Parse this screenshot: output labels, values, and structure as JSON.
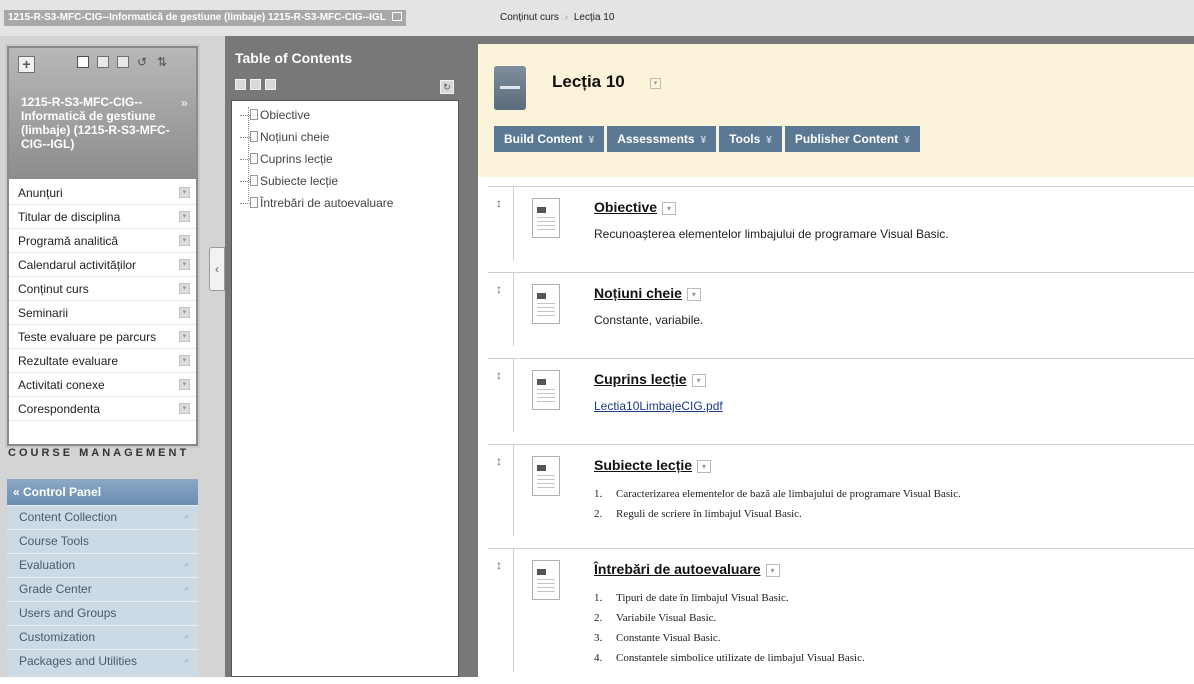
{
  "breadcrumb": {
    "course": "1215-R-S3-MFC-CIG--Informatică de gestiune (limbaje) 1215-R-S3-MFC-CIG--IGL",
    "section": "Conținut curs",
    "current": "Lecția 10"
  },
  "course_menu": {
    "course_title": "1215-R-S3-MFC-CIG--Informatică de gestiune (limbaje) (1215-R-S3-MFC-CIG--IGL)",
    "items": [
      "Anunțuri",
      "Titular de disciplina",
      "Programă analitică",
      "Calendarul activităților",
      "Conținut curs",
      "Seminarii",
      "Teste evaluare pe parcurs",
      "Rezultate evaluare",
      "Activitati conexe",
      "Corespondenta"
    ]
  },
  "course_management": {
    "heading": "COURSE MANAGEMENT",
    "control_panel": "Control Panel",
    "items": [
      "Content Collection",
      "Course Tools",
      "Evaluation",
      "Grade Center",
      "Users and Groups",
      "Customization",
      "Packages and Utilities"
    ]
  },
  "toc": {
    "title": "Table of Contents",
    "items": [
      "Obiective",
      "Noțiuni cheie",
      "Cuprins lecție",
      "Subiecte lecție",
      "Întrebări de autoevaluare"
    ]
  },
  "page": {
    "title": "Lecția 10",
    "actions": [
      "Build Content",
      "Assessments",
      "Tools",
      "Publisher Content"
    ]
  },
  "content_items": [
    {
      "title": "Obiective",
      "text": "Recunoașterea elementelor limbajului de programare Visual Basic."
    },
    {
      "title": "Noțiuni cheie",
      "text": "Constante, variabile."
    },
    {
      "title": "Cuprins lecție",
      "link": "Lectia10LimbajeCIG.pdf"
    },
    {
      "title": "Subiecte lecție",
      "list": [
        "Caracterizarea elementelor de bază ale limbajului de programare Visual Basic.",
        "Reguli de scriere în limbajul Visual Basic."
      ]
    },
    {
      "title": "Întrebări de autoevaluare",
      "list": [
        "Tipuri de date în limbajul Visual Basic.",
        "Variabile Visual Basic.",
        "Constante Visual Basic.",
        "Constantele simbolice utilizate de limbajul Visual Basic."
      ]
    }
  ],
  "colors": {
    "header_bg": "#fcf3db",
    "action_button": "#5b7995",
    "control_panel_head": "#6b8db0"
  }
}
